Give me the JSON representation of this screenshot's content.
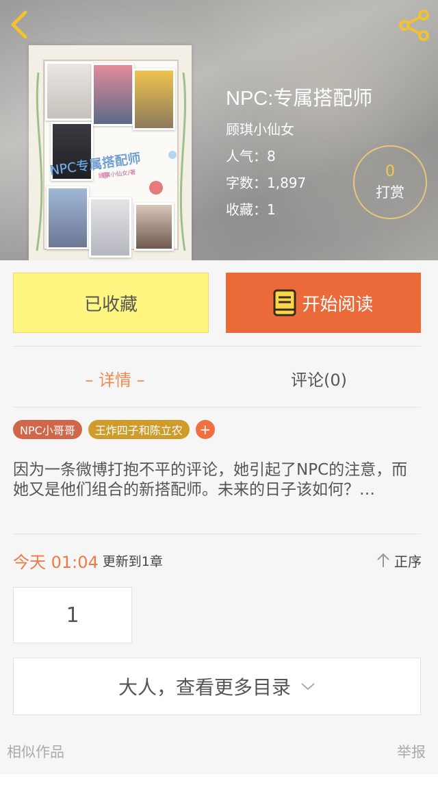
{
  "nav": {
    "back_icon": "chevron-left-icon",
    "share_icon": "share-icon",
    "icon_color": "#f2c230"
  },
  "book": {
    "title": "NPC:专属搭配师",
    "author": "顾琪小仙女",
    "popularity": "人气：8",
    "word_count": "字数：1,897",
    "favorites": "收藏：1"
  },
  "cover": {
    "title_art": "NPC专属搭配师",
    "subtitle_art": "顾琪小仙女/著"
  },
  "reward": {
    "count": "0",
    "label": "打赏"
  },
  "actions": {
    "favorite_label": "已收藏",
    "read_label": "开始阅读",
    "read_icon": "book-icon"
  },
  "tabs": {
    "detail": "– 详情 –",
    "comment": "评论(0)"
  },
  "tags": {
    "items": [
      "NPC小哥哥",
      "王炸四子和陈立农"
    ],
    "add": "+"
  },
  "synopsis": "因为一条微博打抱不平的评论，她引起了NPC的注意，而她又是他们组合的新搭配师。未来的日子该如何？…",
  "update": {
    "time": "今天 01:04",
    "text": "更新到1章",
    "sort_label": "正序",
    "sort_icon": "arrow-up-icon"
  },
  "chapters": [
    "1"
  ],
  "more": {
    "label": "大人，查看更多目录",
    "icon": "chevron-down-icon"
  },
  "footer": {
    "similar": "相似作品",
    "report": "举报"
  },
  "colors": {
    "accent": "#ea6a3a",
    "favorite_bg": "#fff681",
    "tab_active": "#f08a52",
    "tag_1": "#d0664a",
    "tag_2": "#cf9b2a"
  }
}
